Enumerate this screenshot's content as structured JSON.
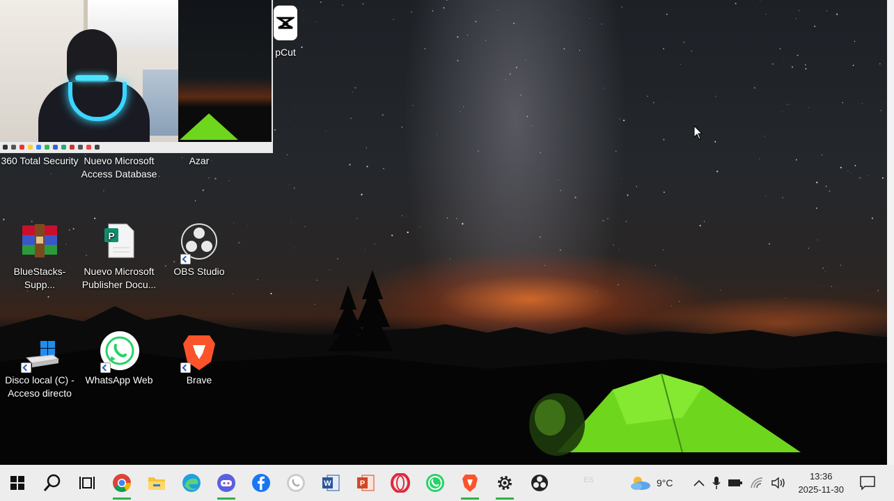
{
  "webcam": {
    "visible": true
  },
  "desktop": {
    "top_partial_icon_label": "pCut",
    "top_row_labels": [
      "360 Total Security",
      "Nuevo Microsoft Access Database",
      "Azar"
    ],
    "icons": [
      {
        "label": "BlueStacks-Supp...",
        "icon": "winrar-archive-icon"
      },
      {
        "label": "Nuevo Microsoft Publisher Docu...",
        "icon": "publisher-document-icon"
      },
      {
        "label": "OBS Studio",
        "icon": "obs-studio-icon"
      },
      {
        "label": "Disco local (C) - Acceso directo",
        "icon": "local-disk-icon"
      },
      {
        "label": "WhatsApp Web",
        "icon": "whatsapp-icon"
      },
      {
        "label": "Brave",
        "icon": "brave-icon"
      }
    ]
  },
  "taskbar": {
    "items": [
      {
        "icon": "windows-start-icon",
        "active": false
      },
      {
        "icon": "search-icon",
        "active": false
      },
      {
        "icon": "task-view-icon",
        "active": false
      },
      {
        "icon": "chrome-icon",
        "active": true
      },
      {
        "icon": "file-explorer-icon",
        "active": false
      },
      {
        "icon": "edge-icon",
        "active": false
      },
      {
        "icon": "gaming-app-icon",
        "active": true
      },
      {
        "icon": "facebook-icon",
        "active": false
      },
      {
        "icon": "whatsapp-icon",
        "active": false
      },
      {
        "icon": "word-icon",
        "active": false
      },
      {
        "icon": "powerpoint-icon",
        "active": false
      },
      {
        "icon": "opera-icon",
        "active": false
      },
      {
        "icon": "whatsapp-icon",
        "active": false
      },
      {
        "icon": "brave-icon",
        "active": true
      },
      {
        "icon": "settings-gear-icon",
        "active": true
      },
      {
        "icon": "obs-icon",
        "active": false
      }
    ],
    "lang": "ES",
    "weather": "9°C",
    "time": "13:36",
    "date": "2025-11-30"
  },
  "colors": {
    "taskbar_bg": "#ededed",
    "active_indicator": "#2fb14a",
    "tent_green": "#6ed61d"
  }
}
